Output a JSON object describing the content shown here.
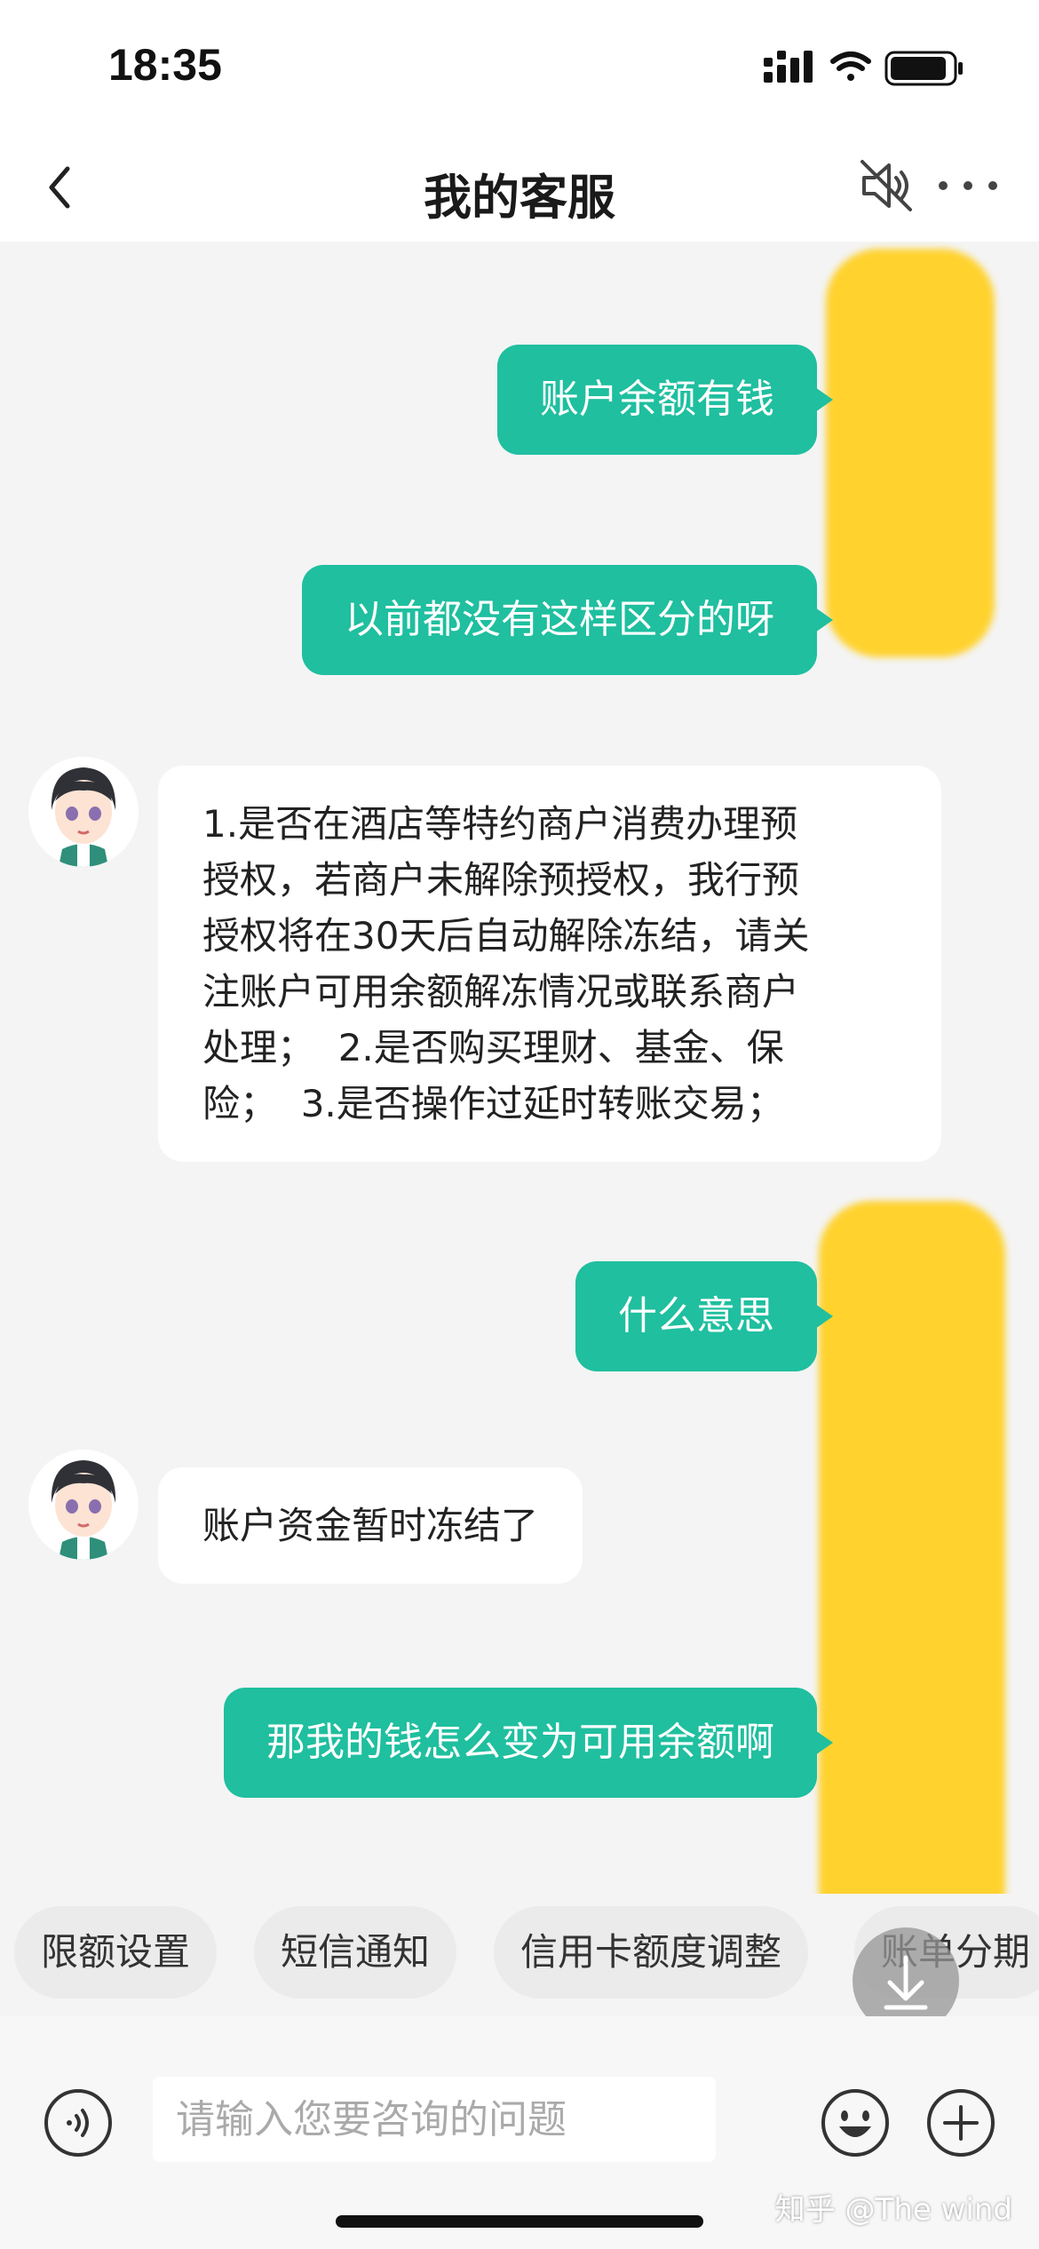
{
  "status_bar": {
    "time": "18:35"
  },
  "header": {
    "title": "我的客服"
  },
  "messages": [
    {
      "from": "user",
      "text": "账户余额有钱"
    },
    {
      "from": "user",
      "text": "以前都没有这样区分的呀"
    },
    {
      "from": "agent",
      "lines": [
        "1.是否在酒店等特约商户消费办理预",
        "授权，若商户未解除预授权，我行预",
        "授权将在30天后自动解除冻结，请关",
        "注账户可用余额解冻情况或联系商户",
        "处理；  2.是否购买理财、基金、保",
        "险；  3.是否操作过延时转账交易；"
      ]
    },
    {
      "from": "user",
      "text": "什么意思"
    },
    {
      "from": "agent",
      "text": "账户资金暂时冻结了"
    },
    {
      "from": "user",
      "text": "那我的钱怎么变为可用余额啊"
    }
  ],
  "quick_replies": [
    "限额设置",
    "短信通知",
    "信用卡额度调整",
    "账单分期"
  ],
  "input": {
    "placeholder": "请输入您要咨询的问题"
  },
  "watermark": "知乎 @The wind",
  "colors": {
    "accent": "#1fbf9f",
    "redaction": "#ffd22e"
  }
}
